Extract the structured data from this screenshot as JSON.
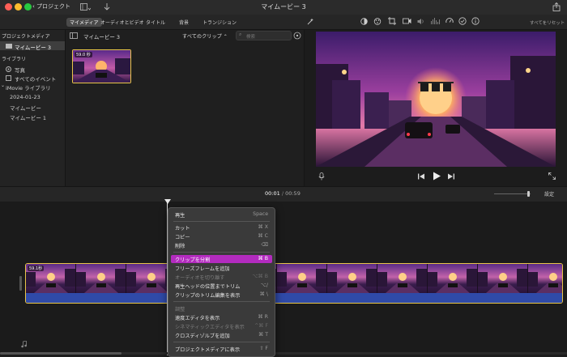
{
  "titlebar": {
    "back_label": "プロジェクト",
    "title": "マイムービー 3"
  },
  "tabs": [
    {
      "label": "マイメディア"
    },
    {
      "label": "オーディオとビデオ"
    },
    {
      "label": "タイトル"
    },
    {
      "label": "背景"
    },
    {
      "label": "トランジション"
    }
  ],
  "reset_all_label": "すべてをリセット",
  "sidebar": {
    "project_media_heading": "プロジェクトメディア",
    "project_item": "マイムービー 3",
    "libraries_heading": "ライブラリ",
    "photos": "写真",
    "all_events": "すべてのイベント",
    "library": "iMovie ライブラリ",
    "items": [
      "2024-01-23",
      "マイムービー",
      "マイムービー 1"
    ]
  },
  "browser": {
    "title": "マイムービー 3",
    "filter": "すべてのクリップ",
    "search_placeholder": "検索",
    "clip_duration": "59.0 秒"
  },
  "playback": {
    "current": "00:01",
    "separator": "/",
    "total": "00:59",
    "settings_label": "設定"
  },
  "timeline": {
    "clip_duration": "59.1秒"
  },
  "context_menu": {
    "items": [
      {
        "label": "再生",
        "shortcut": "Space",
        "disabled": false
      },
      {
        "label": "カット",
        "shortcut": "⌘ X",
        "disabled": false
      },
      {
        "label": "コピー",
        "shortcut": "⌘ C",
        "disabled": false
      },
      {
        "label": "削除",
        "shortcut": "⌫",
        "disabled": false
      },
      {
        "label": "クリップを分割",
        "shortcut": "⌘ B",
        "disabled": false,
        "highlighted": true
      },
      {
        "label": "フリーズフレームを追加",
        "shortcut": "",
        "disabled": false
      },
      {
        "label": "オーディオを切り離す",
        "shortcut": "⌥⌘ B",
        "disabled": true
      },
      {
        "label": "再生ヘッドの位置までトリム",
        "shortcut": "⌥/",
        "disabled": false
      },
      {
        "label": "クリップのトリム編集を表示",
        "shortcut": "⌘ \\",
        "disabled": false
      },
      {
        "label": "調整",
        "shortcut": "",
        "disabled": true
      },
      {
        "label": "速度エディタを表示",
        "shortcut": "⌘ R",
        "disabled": false
      },
      {
        "label": "シネマティックエディタを表示",
        "shortcut": "^⌘ F",
        "disabled": true
      },
      {
        "label": "クロスディゾルブを追加",
        "shortcut": "⌘ T",
        "disabled": false
      },
      {
        "label": "プロジェクトメディアに表示",
        "shortcut": "⇧ F",
        "disabled": false
      }
    ]
  },
  "colors": {
    "accent": "#b32bbf",
    "clip_border": "#e8c548",
    "audio_strip": "#2f4aa8"
  }
}
